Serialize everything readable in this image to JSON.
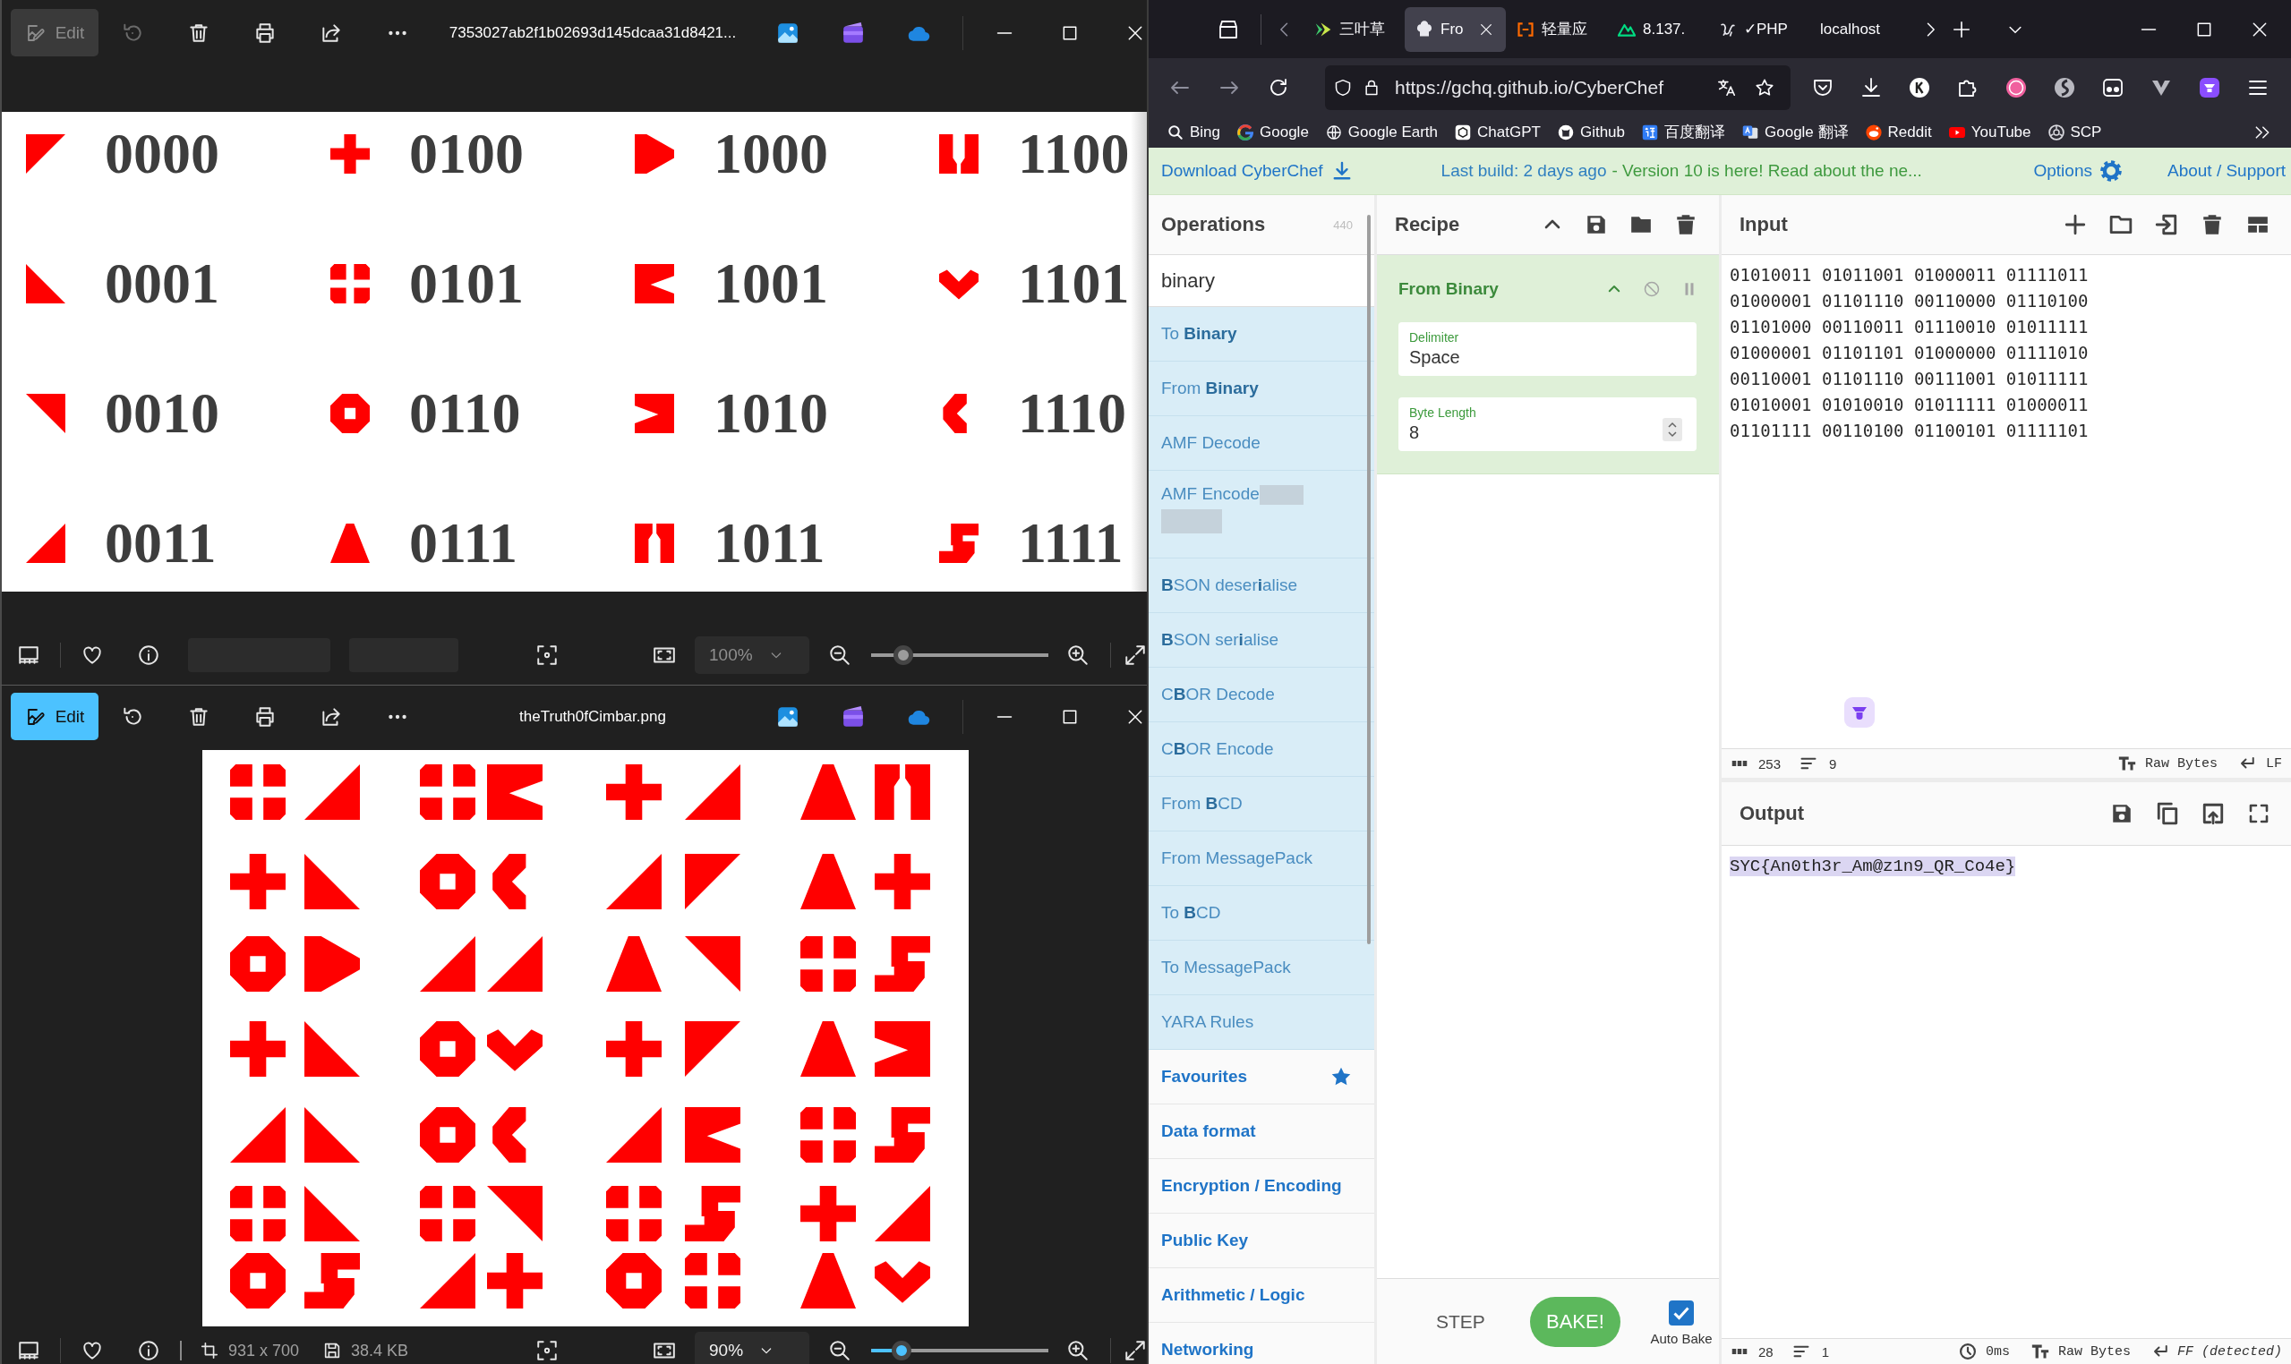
{
  "photo_windows": [
    {
      "active": false,
      "title": "7353027ab2f1b02693d145dcaa31d8421...",
      "edit": "Edit",
      "image": {
        "kind": "legend",
        "codes": [
          "0000",
          "0100",
          "1000",
          "1100",
          "0001",
          "0101",
          "1001",
          "1101",
          "0010",
          "0110",
          "1010",
          "1110",
          "0011",
          "0111",
          "1011",
          "1111"
        ]
      },
      "toolbar": {
        "zoom": "100%",
        "level": 0.18
      }
    },
    {
      "active": true,
      "title": "theTruth0fCimbar.png",
      "edit": "Edit",
      "image": {
        "kind": "symbol_grid"
      },
      "toolbar": {
        "dimensions": "931 x 700",
        "file_size": "38.4 KB",
        "zoom": "90%",
        "level": 0.17
      }
    }
  ],
  "browser": {
    "tabs": [
      {
        "label": "三叶草",
        "selected": false
      },
      {
        "label": "Fro",
        "selected": true
      },
      {
        "label": "轻量应",
        "selected": false
      },
      {
        "label": "8.137.",
        "selected": false
      },
      {
        "label": "✓PHP",
        "selected": false
      },
      {
        "label": "localhost",
        "selected": false
      }
    ],
    "url": "https://gchq.github.io/CyberChef",
    "bookmarks": [
      "Bing",
      "Google",
      "Google Earth",
      "ChatGPT",
      "Github",
      "百度翻译",
      "Google 翻译",
      "Reddit",
      "YouTube",
      "SCP"
    ]
  },
  "cyberchef": {
    "banner": {
      "download": "Download CyberChef",
      "build": "Last build: 2 days ago",
      "notice": "- Version 10 is here! Read about the ne...",
      "options": "Options",
      "about": "About / Support"
    },
    "operations": {
      "title": "Operations",
      "count": "440",
      "search": "binary",
      "results": [
        "To **Binary**",
        "From **Binary**",
        "AMF Decode",
        "AMF Encode",
        "**B**SON deser**i**alise",
        "**B**SON ser**i**alise",
        "C**B**OR Decode",
        "C**B**OR Encode",
        "From **B**CD",
        "From MessagePack",
        "To **B**CD",
        "To MessagePack",
        "YARA Rules"
      ],
      "categories": [
        "Favourites",
        "Data format",
        "Encryption / Encoding",
        "Public Key",
        "Arithmetic / Logic",
        "Networking"
      ]
    },
    "recipe": {
      "title": "Recipe",
      "steps": [
        {
          "name": "From Binary",
          "args": [
            {
              "label": "Delimiter",
              "value": "Space",
              "kind": "text"
            },
            {
              "label": "Byte Length",
              "value": "8",
              "kind": "number"
            }
          ]
        }
      ],
      "step_button": "STEP",
      "bake_button": "BAKE!",
      "auto_bake": {
        "label": "Auto Bake",
        "checked": true
      }
    },
    "input": {
      "title": "Input",
      "lines": [
        "01010011 01011001 01000011 01111011",
        "01000001 01101110 00110000 01110100",
        "01101000 00110011 01110010 01011111",
        "01000001 01101101 01000000 01111010",
        "00110001 01101110 00111001 01011111",
        "01010001 01010010 01011111 01000011",
        "01101111 00110100 01100101 01111101"
      ],
      "status": {
        "length": "253",
        "lines": "9",
        "encoding": "Raw Bytes",
        "eol": "LF"
      }
    },
    "output": {
      "title": "Output",
      "text": "SYC{An0th3r_Am@z1n9_QR_Co4e}",
      "status": {
        "length": "28",
        "lines": "1",
        "time": "0ms",
        "encoding": "Raw Bytes",
        "eol": "FF (detected)"
      }
    }
  }
}
